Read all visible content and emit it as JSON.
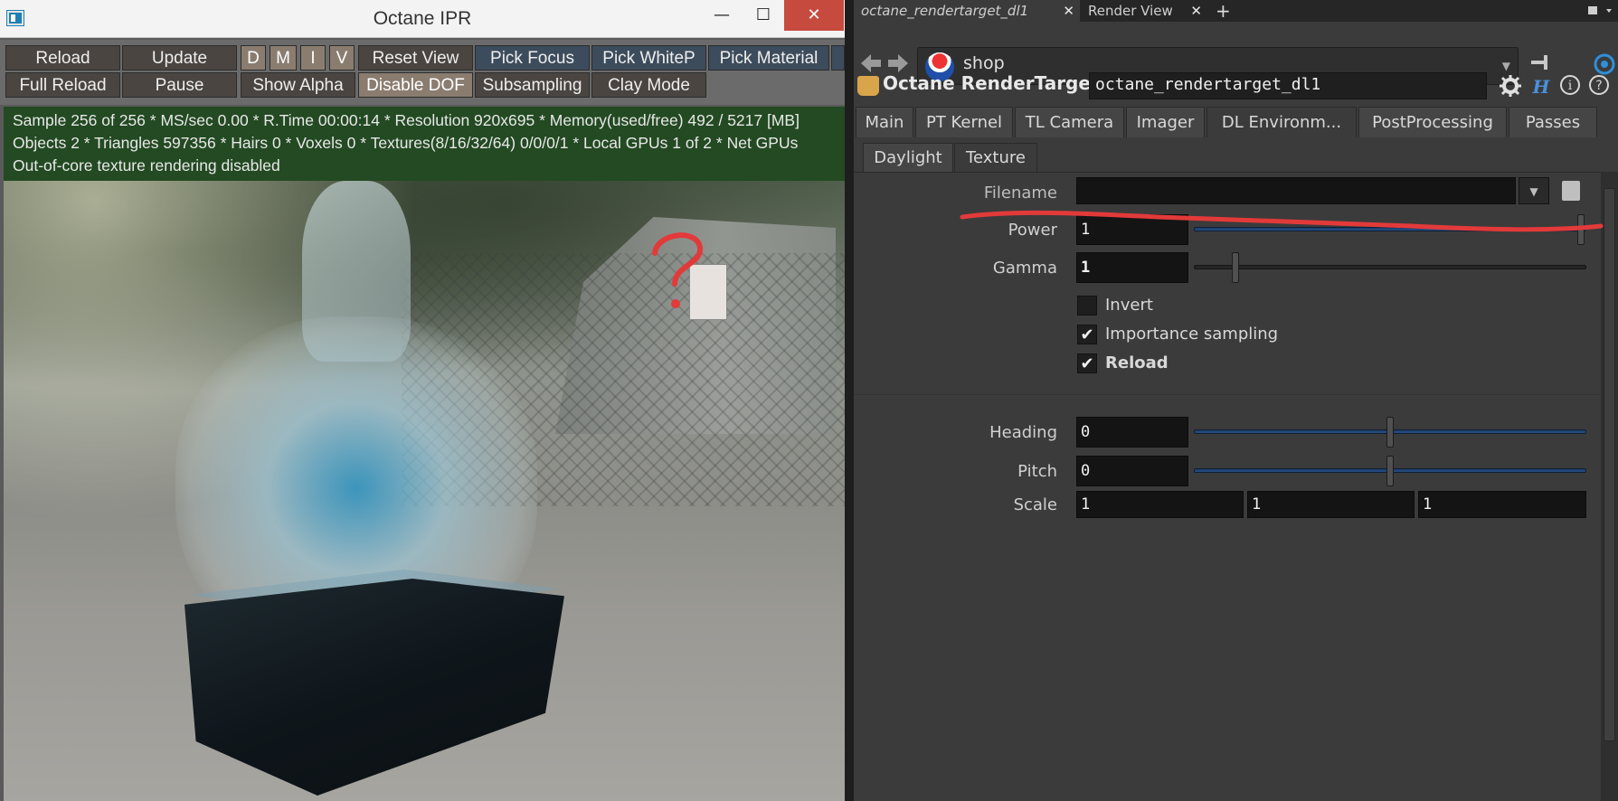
{
  "ipr": {
    "title": "Octane IPR",
    "window_buttons": {
      "minimize": "—",
      "maximize": "☐",
      "close": "✕"
    },
    "toolbar_row1": [
      "Reload",
      "Update",
      "D",
      "M",
      "I",
      "V",
      "Reset View",
      "Pick Focus",
      "Pick WhiteP",
      "Pick Material"
    ],
    "toolbar_row2": [
      "Full Reload",
      "Pause",
      "Show Alpha",
      "Disable DOF",
      "Subsampling",
      "Clay Mode"
    ],
    "status": {
      "line1": "Sample 256 of 256 * MS/sec 0.00 * R.Time 00:00:14 * Resolution 920x695 * Memory(used/free) 492 / 5217 [MB]",
      "line2": "Objects 2 * Triangles 597356 * Hairs 0 * Voxels 0 * Textures(8/16/32/64) 0/0/0/1 * Local GPUs 1 of 2 * Net GPUs",
      "line3": "Out-of-core texture rendering disabled"
    },
    "annotation_text": "?"
  },
  "panel": {
    "tabs": [
      {
        "label": "octane_rendertarget_dl1",
        "close": "✕"
      },
      {
        "label": "Render View",
        "close": "✕"
      }
    ],
    "add_tab": "+",
    "path": "shop",
    "node_type": "Octane RenderTarget",
    "node_name": "octane_rendertarget_dl1",
    "subtabs": [
      "Main",
      "PT Kernel",
      "TL Camera",
      "Imager",
      "DL Environm...",
      "PostProcessing",
      "Passes"
    ],
    "env_tabs": [
      "Daylight",
      "Texture"
    ],
    "params": {
      "filename": {
        "label": "Filename",
        "value": ""
      },
      "power": {
        "label": "Power",
        "value": "1"
      },
      "gamma": {
        "label": "Gamma",
        "value": "1"
      },
      "invert": {
        "label": "Invert",
        "checked": false
      },
      "importance": {
        "label": "Importance sampling",
        "checked": true
      },
      "reload": {
        "label": "Reload",
        "checked": true
      },
      "heading": {
        "label": "Heading",
        "value": "0"
      },
      "pitch": {
        "label": "Pitch",
        "value": "0"
      },
      "scale": {
        "label": "Scale",
        "values": [
          "1",
          "1",
          "1"
        ]
      }
    },
    "icons": {
      "back": "arrow-left-icon",
      "forward": "arrow-right-icon",
      "pin": "pin-icon",
      "gear": "gear-icon",
      "help": "help-icon",
      "info": "info-icon",
      "houdini": "houdini-icon"
    },
    "checkmark": "✔"
  },
  "colors": {
    "status_bg": "#234a22",
    "annotation_red": "#e23a3a",
    "slider_blue": "#274e82"
  }
}
